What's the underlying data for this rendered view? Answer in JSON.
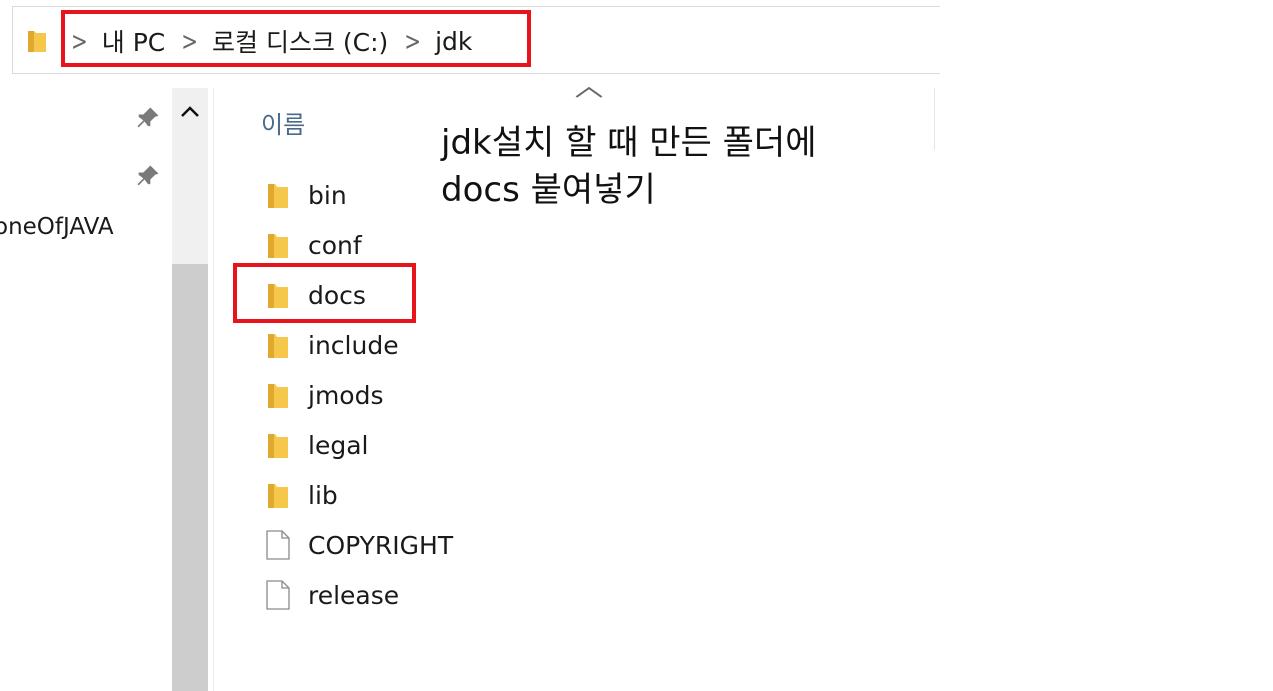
{
  "address_bar": {
    "crumbs": [
      {
        "label": "내 PC"
      },
      {
        "label": "로컬 디스크 (C:)"
      },
      {
        "label": "jdk"
      }
    ]
  },
  "nav_pane": {
    "visible_item": "oneOfJAVA"
  },
  "file_list": {
    "column_header": "이름",
    "items": [
      {
        "name": "bin",
        "type": "folder"
      },
      {
        "name": "conf",
        "type": "folder"
      },
      {
        "name": "docs",
        "type": "folder"
      },
      {
        "name": "include",
        "type": "folder"
      },
      {
        "name": "jmods",
        "type": "folder"
      },
      {
        "name": "legal",
        "type": "folder"
      },
      {
        "name": "lib",
        "type": "folder"
      },
      {
        "name": "COPYRIGHT",
        "type": "file"
      },
      {
        "name": "release",
        "type": "file"
      }
    ]
  },
  "annotation": {
    "line1": "jdk설치 할 때 만든 폴더에",
    "line2": "docs 붙여넣기"
  },
  "colors": {
    "highlight": "#e8141c",
    "folder": "#f5c74a",
    "header_text": "#4a6a8a"
  }
}
